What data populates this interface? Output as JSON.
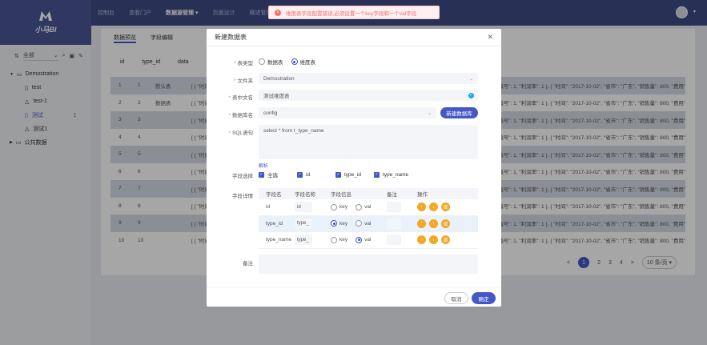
{
  "app": {
    "title": "小马BI"
  },
  "nav": {
    "items": [
      {
        "label": "控制台",
        "active": false
      },
      {
        "label": "查看门户",
        "active": false
      },
      {
        "label": "数据源管理 ▾",
        "active": true
      },
      {
        "label": "页面设计",
        "active": false
      },
      {
        "label": "概述管理",
        "active": false
      }
    ]
  },
  "sidebar": {
    "filter": {
      "label": "全部"
    },
    "tree": [
      {
        "label": "Demostration",
        "level": 0,
        "icon": "folder-icon",
        "expanded": true
      },
      {
        "label": "test",
        "level": 1,
        "icon": "file-icon"
      },
      {
        "label": "test-1",
        "level": 1,
        "icon": "cloud-icon"
      },
      {
        "label": "测试",
        "level": 1,
        "icon": "file-icon",
        "selected": true
      },
      {
        "label": "测试1",
        "level": 1,
        "icon": "cloud-icon"
      },
      {
        "label": "公共数据",
        "level": 0,
        "icon": "folder-icon",
        "expanded": false
      }
    ]
  },
  "content": {
    "tabs": [
      {
        "label": "数据预览",
        "active": true
      },
      {
        "label": "字段编辑",
        "active": false
      }
    ],
    "columns": [
      "id",
      "type_id",
      "data"
    ],
    "rows": [
      {
        "id": "1",
        "type_id": "1",
        "name": "默认表",
        "data": "[ { \"时间\":",
        "tail": "00, \"编号\": 1, \"利润率\": 1 }, { \"时间\": \"2017-10-02\", \"省市\": \"广东\", \"销售量\": 800, \"费用\": 900, \"编"
      },
      {
        "id": "2",
        "type_id": "2",
        "name": "数据表",
        "data": "[ { \"时间\":",
        "tail": "00, \"编号\": 1, \"利润率\": 1 }, { \"时间\": \"2017-10-02\", \"省市\": \"广东\", \"销售量\": 800, \"费用\": 900, \"编"
      },
      {
        "id": "3",
        "type_id": "3",
        "name": "",
        "data": "[ { \"时间\":",
        "tail": "00, \"编号\": 1, \"利润率\": 1 }, { \"时间\": \"2017-10-02\", \"省市\": \"广东\", \"销售量\": 800, \"费用\": 900, \"编"
      },
      {
        "id": "4",
        "type_id": "4",
        "name": "",
        "data": "[ { \"时间\":",
        "tail": "00, \"编号\": 1, \"利润率\": 1 }, { \"时间\": \"2017-10-02\", \"省市\": \"广东\", \"销售量\": 800, \"费用\": 900, \"编"
      },
      {
        "id": "5",
        "type_id": "5",
        "name": "",
        "data": "[ { \"时间\":",
        "tail": "00, \"编号\": 1, \"利润率\": 1 }, { \"时间\": \"2017-10-02\", \"省市\": \"广东\", \"销售量\": 800, \"费用\": 900, \"编"
      },
      {
        "id": "6",
        "type_id": "6",
        "name": "",
        "data": "[ { \"时间\":",
        "tail": "00, \"编号\": 1, \"利润率\": 1 }, { \"时间\": \"2017-10-02\", \"省市\": \"广东\", \"销售量\": 800, \"费用\": 900, \"编"
      },
      {
        "id": "7",
        "type_id": "7",
        "name": "",
        "data": "[ { \"时间\":",
        "tail": "00, \"编号\": 1, \"利润率\": 1 }, { \"时间\": \"2017-10-02\", \"省市\": \"广东\", \"销售量\": 800, \"费用\": 900, \"编"
      },
      {
        "id": "8",
        "type_id": "8",
        "name": "",
        "data": "[ { \"时间\":",
        "tail": "00, \"编号\": 1, \"利润率\": 1 }, { \"时间\": \"2017-10-02\", \"省市\": \"广东\", \"销售量\": 800, \"费用\": 900, \"编"
      },
      {
        "id": "9",
        "type_id": "9",
        "name": "",
        "data": "[ { \"时间\":",
        "tail": "00, \"编号\": 1, \"利润率\": 1 }, { \"时间\": \"2017-10-02\", \"省市\": \"广东\", \"销售量\": 800, \"费用\": 900, \"编"
      },
      {
        "id": "10",
        "type_id": "10",
        "name": "",
        "data": "[ { \"时间\":",
        "tail": "00, \"编号\": 1, \"利润率\": 1 }, { \"时间\": \"2017-10-02\", \"省市\": \"广东\", \"销售量\": 800, \"费用\": 900, \"编"
      }
    ],
    "pagination": {
      "prev": "<",
      "pages": [
        "1",
        "2",
        "3",
        "4"
      ],
      "current": "1",
      "next": ">",
      "page_size": "10 条/页 ▾"
    }
  },
  "toast": {
    "message": "维度表字段配置错误,必须设置一个key字段和一个val字段"
  },
  "modal": {
    "title": "新建数据表",
    "source_type": {
      "label": "表类型",
      "options": [
        "数据表",
        "维度表"
      ],
      "selected": "维度表"
    },
    "folder": {
      "label": "文件夹",
      "value": "Demostration"
    },
    "cn_name": {
      "label": "表中文名",
      "value": "测试维度表"
    },
    "db_name": {
      "label": "数据库名",
      "value": "config",
      "new_button": "新建数据库"
    },
    "sql": {
      "label": "SQL语句",
      "value": "select * from t_type_name",
      "parse_link": "解析"
    },
    "field_select": {
      "label": "字段选择",
      "options": [
        "全选",
        "id",
        "type_id",
        "type_name"
      ]
    },
    "field_detail": {
      "label": "字段详情",
      "headers": [
        "字段名",
        "字段名称",
        "字段信息",
        "备注",
        "操作"
      ],
      "rows": [
        {
          "field": "id",
          "name": "id",
          "key": false,
          "val": false
        },
        {
          "field": "type_id",
          "name": "type_",
          "key": true,
          "val": false
        },
        {
          "field": "type_name",
          "name": "type_",
          "key": false,
          "val": true
        }
      ],
      "key_label": "key",
      "val_label": "val"
    },
    "remark": {
      "label": "备注",
      "value": ""
    },
    "cancel_label": "取消",
    "confirm_label": "确定"
  },
  "colors": {
    "primary": "#4457c7",
    "nav_bg": "#3f4a84",
    "error": "#f56c6c",
    "warning": "#f5a623"
  }
}
